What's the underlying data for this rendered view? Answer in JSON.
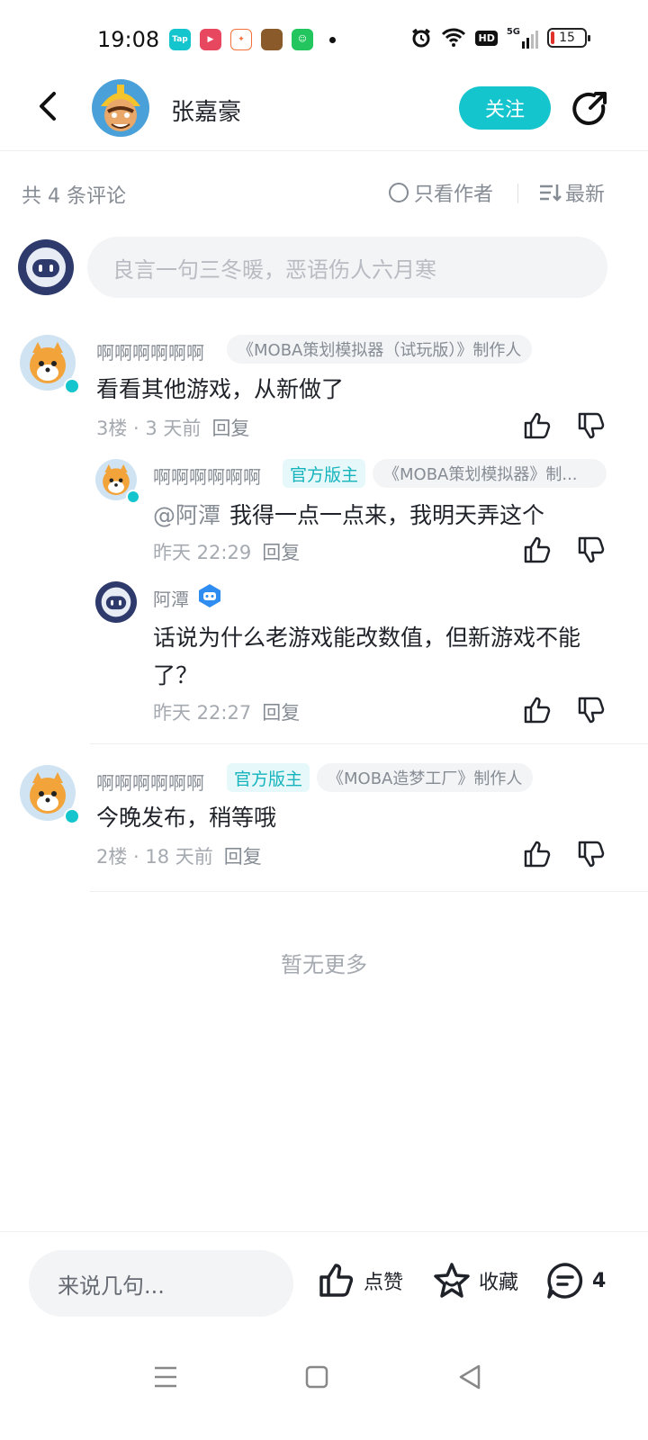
{
  "status_bar": {
    "time": "19:08",
    "apps": [
      {
        "name": "taptap-app-icon",
        "label": "Tap",
        "color": "#15c5ce"
      },
      {
        "name": "video-app-icon",
        "label": "",
        "color": "#e8485f"
      },
      {
        "name": "game-center-app-icon",
        "label": "",
        "color": "#f2713a"
      },
      {
        "name": "hero-game-app-icon",
        "label": "",
        "color": "#8a5a2b"
      },
      {
        "name": "green-app-icon",
        "label": "",
        "color": "#22c55e"
      }
    ],
    "network_hd": "HD",
    "network_5g": "5G",
    "battery": "15"
  },
  "header": {
    "author_name": "张嘉豪",
    "follow_label": "关注"
  },
  "comments_header": {
    "count_label": "共 4 条评论",
    "only_author_label": "只看作者",
    "sort_label": "最新"
  },
  "composer": {
    "placeholder": "良言一句三冬暖，恶语伤人六月寒"
  },
  "comments": [
    {
      "user": "啊啊啊啊啊啊",
      "game_tag": "《MOBA策划模拟器（试玩版）》制作人",
      "text": "看看其他游戏，从新做了",
      "meta": "3楼 · 3 天前",
      "reply_label": "回复",
      "replies": [
        {
          "user": "啊啊啊啊啊啊",
          "official_tag": "官方版主",
          "game_tag": "《MOBA策划模拟器》制...",
          "mention": "@阿潭",
          "text": "我得一点一点来，我明天弄这个",
          "meta": "昨天 22:29",
          "reply_label": "回复"
        },
        {
          "user": "阿潭",
          "text": "话说为什么老游戏能改数值，但新游戏不能了？",
          "meta": "昨天 22:27",
          "reply_label": "回复"
        }
      ]
    },
    {
      "user": "啊啊啊啊啊啊",
      "official_tag": "官方版主",
      "game_tag": "《MOBA造梦工厂》制作人",
      "text": "今晚发布，稍等哦",
      "meta": "2楼 · 18 天前",
      "reply_label": "回复"
    }
  ],
  "no_more_label": "暂无更多",
  "bottom_bar": {
    "input_placeholder": "来说几句...",
    "like_label": "点赞",
    "favorite_label": "收藏",
    "comment_count": "4"
  },
  "colors": {
    "accent": "#15c5ce",
    "text_primary": "#1f2329",
    "text_secondary": "#868c94"
  }
}
